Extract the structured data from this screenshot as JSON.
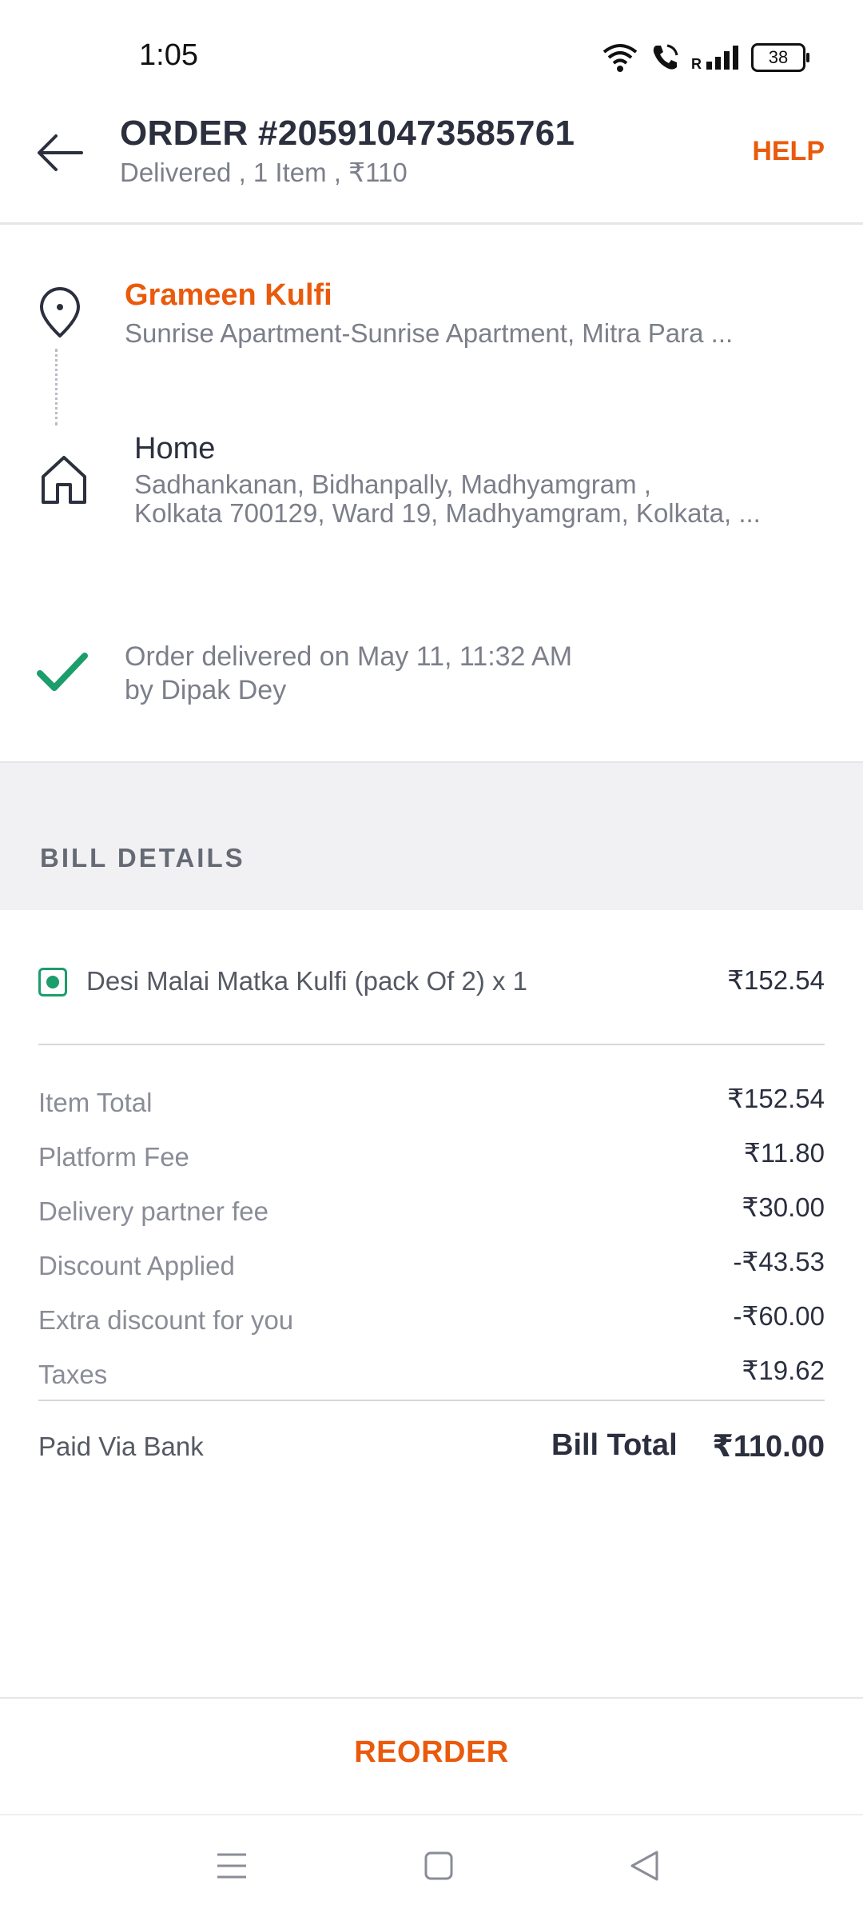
{
  "status_bar": {
    "time": "1:05",
    "signal_label": "R",
    "battery": "38",
    "icons": [
      "wifi-icon",
      "call-icon",
      "signal-icon",
      "battery-icon"
    ]
  },
  "header": {
    "title": "ORDER #205910473585761",
    "subtitle": "Delivered , 1 Item , ₹110",
    "help_label": "HELP",
    "back_icon": "arrow-left-icon"
  },
  "pickup": {
    "name": "Grameen Kulfi",
    "address": "Sunrise Apartment-Sunrise Apartment, Mitra Para ...",
    "icon": "location-pin-icon"
  },
  "dropoff": {
    "title": "Home",
    "address_line1": "Sadhankanan, Bidhanpally, Madhyamgram ,",
    "address_line2": "Kolkata 700129, Ward 19, Madhyamgram, Kolkata, ...",
    "icon": "home-icon"
  },
  "delivery": {
    "line1": "Order delivered on May 11, 11:32 AM",
    "line2": "by Dipak Dey",
    "icon": "check-icon"
  },
  "bill": {
    "section_title": "BILL DETAILS",
    "item": {
      "name": "Desi Malai Matka Kulfi (pack Of 2) x 1",
      "price": "₹152.54",
      "veg_icon": "veg-indicator-icon"
    },
    "rows": [
      {
        "label": "Item Total",
        "value": "₹152.54"
      },
      {
        "label": "Platform Fee",
        "value": "₹11.80"
      },
      {
        "label": "Delivery partner fee",
        "value": "₹30.00"
      },
      {
        "label": "Discount Applied",
        "value": "-₹43.53"
      },
      {
        "label": "Extra discount for you",
        "value": "-₹60.00"
      },
      {
        "label": "Taxes",
        "value": "₹19.62"
      }
    ],
    "paid_via": "Paid Via Bank",
    "total_label": "Bill Total",
    "total_value": "₹110.00"
  },
  "footer": {
    "reorder_label": "REORDER"
  },
  "colors": {
    "accent": "#ea5a0c",
    "success": "#1b9d6c",
    "text_dark": "#2b2f3e",
    "text_muted": "#7c7f8a",
    "band_bg": "#f1f1f3"
  }
}
